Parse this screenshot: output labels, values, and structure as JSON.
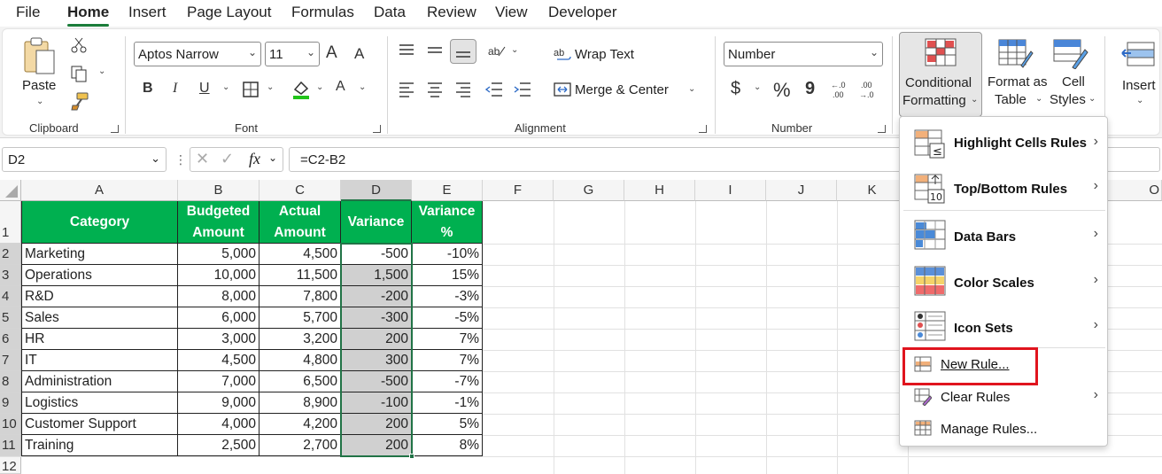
{
  "menu_tabs": [
    "File",
    "Home",
    "Insert",
    "Page Layout",
    "Formulas",
    "Data",
    "Review",
    "View",
    "Developer"
  ],
  "ribbon": {
    "clipboard": {
      "paste_label": "Paste",
      "group_label": "Clipboard"
    },
    "font": {
      "font_name": "Aptos Narrow",
      "font_size": "11",
      "bold": "B",
      "italic": "I",
      "underline": "U",
      "grow": "A",
      "shrink": "A",
      "font_color": "A",
      "group_label": "Font"
    },
    "alignment": {
      "wrap_text": "Wrap Text",
      "merge_center": "Merge & Center",
      "group_label": "Alignment"
    },
    "number": {
      "format": "Number",
      "currency": "$",
      "percent": "%",
      "comma": "9",
      "group_label": "Number"
    },
    "styles": {
      "conditional_formatting_line1": "Conditional",
      "conditional_formatting_line2": "Formatting",
      "format_table_line1": "Format as",
      "format_table_line2": "Table",
      "cell_styles_line1": "Cell",
      "cell_styles_line2": "Styles"
    },
    "cells": {
      "insert": "Insert"
    }
  },
  "formula_bar": {
    "name_box": "D2",
    "fx": "fx",
    "formula": "=C2-B2"
  },
  "columns": [
    "A",
    "B",
    "C",
    "D",
    "E",
    "F",
    "G",
    "H",
    "I",
    "J",
    "K",
    "O"
  ],
  "rows": [
    "1",
    "2",
    "3",
    "4",
    "5",
    "6",
    "7",
    "8",
    "9",
    "10",
    "11",
    "12"
  ],
  "table": {
    "headers": [
      [
        "Category"
      ],
      [
        "Budgeted",
        "Amount"
      ],
      [
        "Actual",
        "Amount"
      ],
      [
        "Variance"
      ],
      [
        "Variance",
        "%"
      ]
    ],
    "data": [
      [
        "Marketing",
        "5,000",
        "4,500",
        "-500",
        "-10%"
      ],
      [
        "Operations",
        "10,000",
        "11,500",
        "1,500",
        "15%"
      ],
      [
        "R&D",
        "8,000",
        "7,800",
        "-200",
        "-3%"
      ],
      [
        "Sales",
        "6,000",
        "5,700",
        "-300",
        "-5%"
      ],
      [
        "HR",
        "3,000",
        "3,200",
        "200",
        "7%"
      ],
      [
        "IT",
        "4,500",
        "4,800",
        "300",
        "7%"
      ],
      [
        "Administration",
        "7,000",
        "6,500",
        "-500",
        "-7%"
      ],
      [
        "Logistics",
        "9,000",
        "8,900",
        "-100",
        "-1%"
      ],
      [
        "Customer Support",
        "4,000",
        "4,200",
        "200",
        "5%"
      ],
      [
        "Training",
        "2,500",
        "2,700",
        "200",
        "8%"
      ]
    ]
  },
  "dropdown": {
    "items": [
      {
        "label": "Highlight Cells Rules",
        "submenu": true,
        "bold": true
      },
      {
        "label": "Top/Bottom Rules",
        "submenu": true,
        "bold": true
      },
      {
        "label": "Data Bars",
        "submenu": true,
        "bold": true
      },
      {
        "label": "Color Scales",
        "submenu": true,
        "bold": true
      },
      {
        "label": "Icon Sets",
        "submenu": true,
        "bold": true
      },
      {
        "label": "New Rule...",
        "submenu": false,
        "bold": false
      },
      {
        "label": "Clear Rules",
        "submenu": true,
        "bold": false
      },
      {
        "label": "Manage Rules...",
        "submenu": false,
        "bold": false
      }
    ],
    "icon_text_le": "≤",
    "icon_text_10": "10"
  },
  "colors": {
    "header_green": "#00b050",
    "accent_green": "#217346",
    "highlight_red": "#e0141e",
    "selected_gray": "#d0d0d0"
  }
}
